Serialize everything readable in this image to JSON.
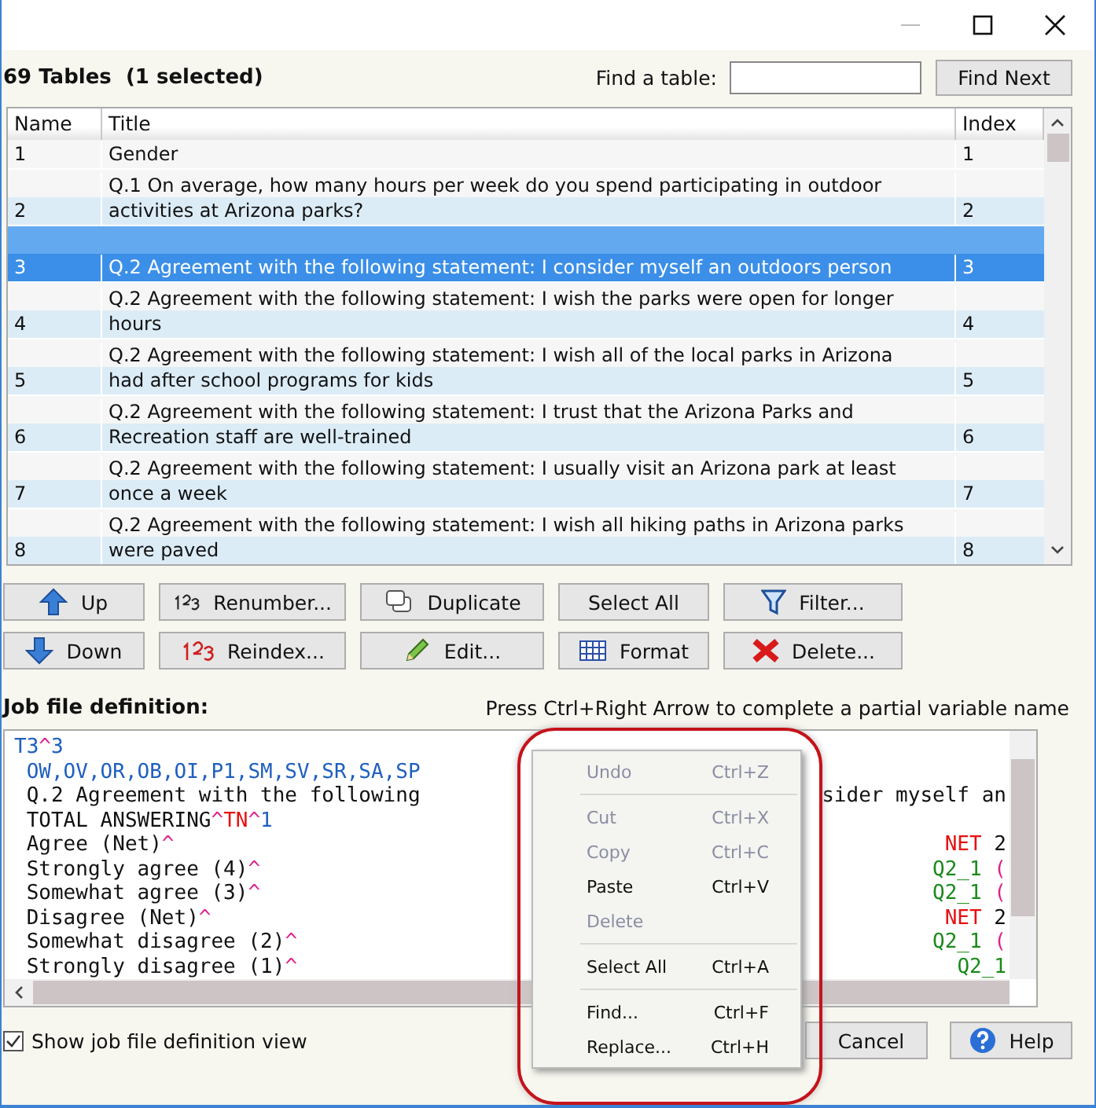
{
  "header": {
    "title": "69 Tables  (1 selected)",
    "find_label": "Find a table:",
    "find_button": "Find Next"
  },
  "table": {
    "columns": [
      "Name",
      "Title",
      "Index"
    ],
    "rows": [
      {
        "name": "1",
        "title": "Gender",
        "index": "1",
        "selected": false
      },
      {
        "name": "2",
        "title": "Q.1 On average, how many hours per week do you spend participating in outdoor activities at Arizona parks?",
        "index": "2",
        "selected": false
      },
      {
        "name": "3",
        "title": "Q.2 Agreement with the following statement: I consider myself an outdoors person",
        "index": "3",
        "selected": true
      },
      {
        "name": "4",
        "title": "Q.2 Agreement with the following statement: I wish the parks were open for longer hours",
        "index": "4",
        "selected": false
      },
      {
        "name": "5",
        "title": "Q.2 Agreement with the following statement: I wish all of the local parks in Arizona had after school programs for kids",
        "index": "5",
        "selected": false
      },
      {
        "name": "6",
        "title": "Q.2 Agreement with the following statement: I trust that the Arizona Parks and Recreation staff are well-trained",
        "index": "6",
        "selected": false
      },
      {
        "name": "7",
        "title": "Q.2 Agreement with the following statement: I usually visit an Arizona park at least once a week",
        "index": "7",
        "selected": false
      },
      {
        "name": "8",
        "title": "Q.2 Agreement with the following statement: I wish all hiking paths in Arizona parks were paved",
        "index": "8",
        "selected": false
      }
    ]
  },
  "buttons": [
    {
      "label": "Up",
      "kind": "up"
    },
    {
      "label": "Renumber...",
      "kind": "renumber"
    },
    {
      "label": "Duplicate",
      "kind": "duplicate"
    },
    {
      "label": "Select All",
      "kind": "none"
    },
    {
      "label": "Filter...",
      "kind": "filter"
    },
    {
      "label": "Down",
      "kind": "down"
    },
    {
      "label": "Reindex...",
      "kind": "reindex"
    },
    {
      "label": "Edit...",
      "kind": "edit"
    },
    {
      "label": "Format",
      "kind": "format"
    },
    {
      "label": "Delete...",
      "kind": "delete"
    }
  ],
  "editor": {
    "label": "Job file definition:",
    "hint": "Press Ctrl+Right Arrow to complete a partial variable name",
    "lines": [
      {
        "left": [
          {
            "text": "T3",
            "kind": "header"
          },
          {
            "text": "^",
            "kind": "caret"
          },
          {
            "text": "3",
            "kind": "header"
          }
        ]
      },
      {
        "left": [
          {
            "text": " OW,OV,OR,OB,OI,P1,SM,SV,SR,SA,SP",
            "kind": "header"
          }
        ]
      },
      {
        "left": [
          {
            "text": " Q.2 Agreement with the following",
            "kind": "plain"
          }
        ],
        "right": [
          {
            "text": "sider myself an",
            "kind": "plain"
          }
        ]
      },
      {
        "left": [
          {
            "text": " TOTAL ANSWERING",
            "kind": "plain"
          },
          {
            "text": "^",
            "kind": "caret"
          },
          {
            "text": "TN",
            "kind": "keyword"
          },
          {
            "text": "^",
            "kind": "caret"
          },
          {
            "text": "1",
            "kind": "header"
          }
        ]
      },
      {
        "left": [
          {
            "text": " Agree (Net)",
            "kind": "plain"
          },
          {
            "text": "^",
            "kind": "caret"
          }
        ],
        "right": [
          {
            "text": "NET",
            "kind": "keyword"
          },
          {
            "text": " 2",
            "kind": "plain"
          }
        ]
      },
      {
        "left": [
          {
            "text": " Strongly agree (4)",
            "kind": "plain"
          },
          {
            "text": "^",
            "kind": "caret"
          }
        ],
        "right": [
          {
            "text": "Q2_1",
            "kind": "variable"
          },
          {
            "text": " (",
            "kind": "caret"
          }
        ]
      },
      {
        "left": [
          {
            "text": " Somewhat agree (3)",
            "kind": "plain"
          },
          {
            "text": "^",
            "kind": "caret"
          }
        ],
        "right": [
          {
            "text": "Q2_1",
            "kind": "variable"
          },
          {
            "text": " (",
            "kind": "caret"
          }
        ]
      },
      {
        "left": [
          {
            "text": " Disagree (Net)",
            "kind": "plain"
          },
          {
            "text": "^",
            "kind": "caret"
          }
        ],
        "right": [
          {
            "text": "NET",
            "kind": "keyword"
          },
          {
            "text": " 2",
            "kind": "plain"
          }
        ]
      },
      {
        "left": [
          {
            "text": " Somewhat disagree (2)",
            "kind": "plain"
          },
          {
            "text": "^",
            "kind": "caret"
          }
        ],
        "right": [
          {
            "text": "Q2_1",
            "kind": "variable"
          },
          {
            "text": " (",
            "kind": "caret"
          }
        ]
      },
      {
        "left": [
          {
            "text": " Strongly disagree (1)",
            "kind": "plain"
          },
          {
            "text": "^",
            "kind": "caret"
          }
        ],
        "right": [
          {
            "text": "Q2_1",
            "kind": "variable"
          }
        ]
      }
    ]
  },
  "show_definition": {
    "label": "Show job file definition view",
    "checked": true
  },
  "footer_buttons": [
    {
      "label": "Cancel",
      "kind": "none"
    },
    {
      "label": "Help",
      "kind": "help"
    }
  ],
  "context_menu": [
    {
      "kind": "item",
      "label": "Undo",
      "shortcut": "Ctrl+Z",
      "disabled": true
    },
    {
      "kind": "separator"
    },
    {
      "kind": "item",
      "label": "Cut",
      "shortcut": "Ctrl+X",
      "disabled": true
    },
    {
      "kind": "item",
      "label": "Copy",
      "shortcut": "Ctrl+C",
      "disabled": true
    },
    {
      "kind": "item",
      "label": "Paste",
      "shortcut": "Ctrl+V",
      "disabled": false
    },
    {
      "kind": "item",
      "label": "Delete",
      "disabled": true
    },
    {
      "kind": "separator"
    },
    {
      "kind": "item",
      "label": "Select All",
      "shortcut": "Ctrl+A",
      "disabled": false
    },
    {
      "kind": "separator"
    },
    {
      "kind": "item",
      "label": "Find...",
      "shortcut": "Ctrl+F",
      "disabled": false
    },
    {
      "kind": "item",
      "label": "Replace...",
      "shortcut": "Ctrl+H",
      "disabled": false
    }
  ]
}
